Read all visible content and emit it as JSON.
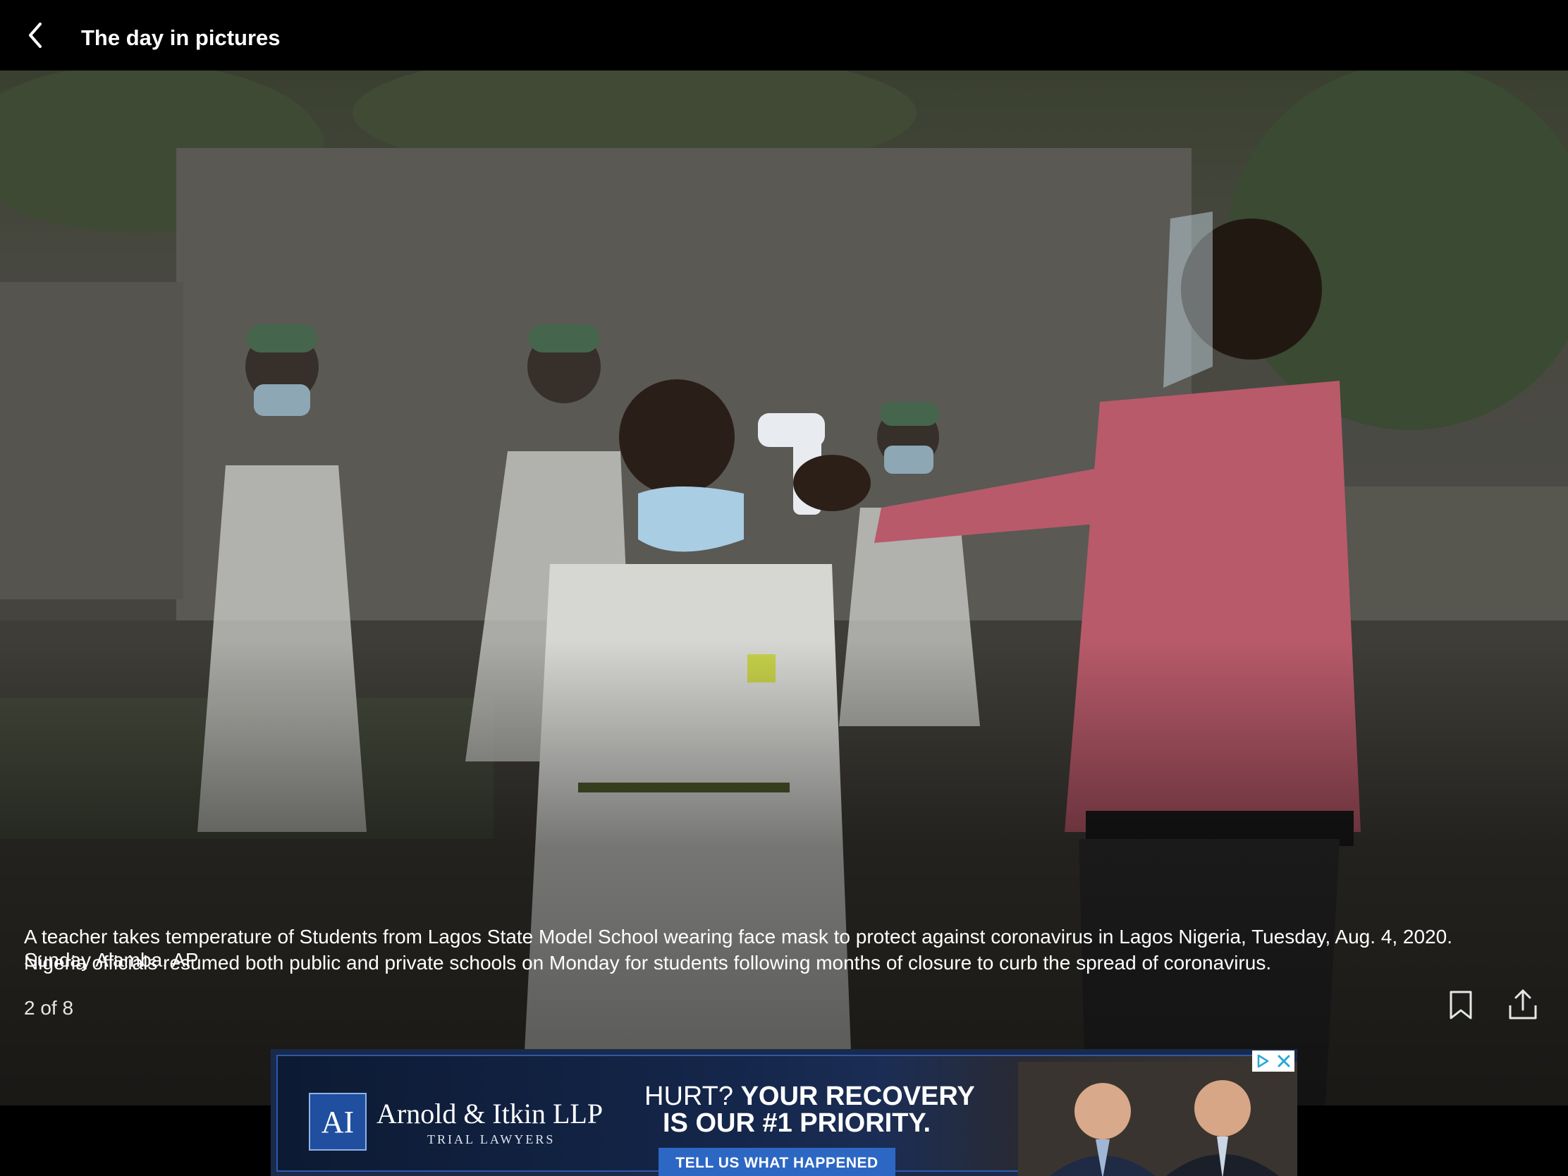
{
  "header": {
    "title": "The day in pictures"
  },
  "photo": {
    "caption": "A teacher takes temperature of Students from Lagos State Model School wearing face mask to protect against coronavirus in Lagos Nigeria, Tuesday, Aug. 4, 2020. Nigeria officials resumed both public and private schools on Monday for students following months of closure to curb the spread of coronavirus.",
    "credit": "Sunday Alamba, AP",
    "counter": "2 of 8",
    "current_index": 2,
    "total": 8
  },
  "actions": {
    "bookmark_icon": "bookmark-icon",
    "share_icon": "share-icon"
  },
  "ad": {
    "logo_letters": "AI",
    "firm_name": "Arnold & Itkin LLP",
    "firm_subtitle": "TRIAL LAWYERS",
    "headline_lead": "HURT?",
    "headline_rest": "YOUR RECOVERY",
    "headline_line2": "IS OUR #1 PRIORITY.",
    "cta": "TELL US WHAT HAPPENED",
    "brand_color": "#1f4f9e",
    "cta_color": "#2d67c4"
  }
}
